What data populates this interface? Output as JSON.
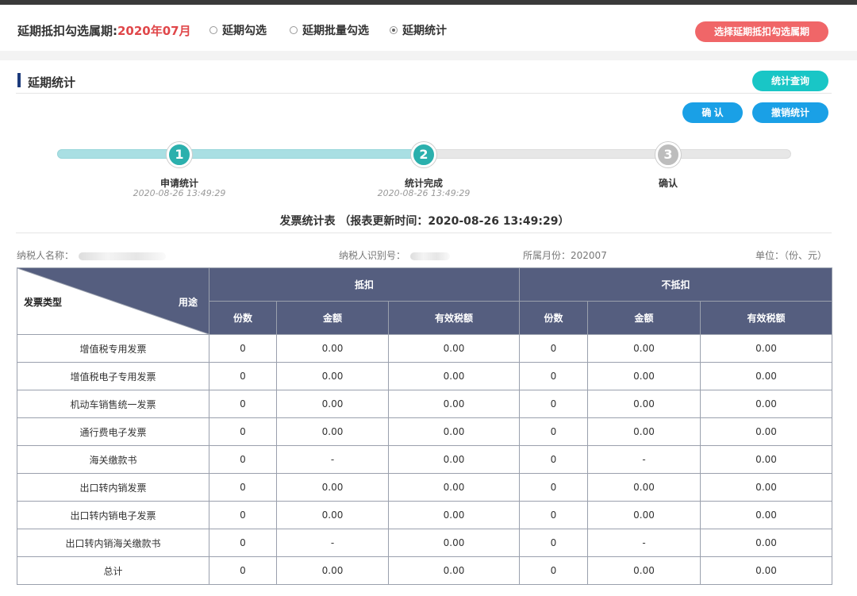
{
  "header": {
    "period_label": "延期抵扣勾选属期:",
    "period_value": "2020年07月",
    "radios": [
      {
        "label": "延期勾选",
        "checked": false
      },
      {
        "label": "延期批量勾选",
        "checked": false
      },
      {
        "label": "延期统计",
        "checked": true
      }
    ],
    "select_period_button": "选择延期抵扣勾选属期"
  },
  "section": {
    "title": "延期统计",
    "query_button": "统计查询",
    "confirm_button": "确 认",
    "cancel_button": "撤销统计"
  },
  "steps": [
    {
      "number": "1",
      "title": "申请统计",
      "time": "2020-08-26 13:49:29",
      "status": "done"
    },
    {
      "number": "2",
      "title": "统计完成",
      "time": "2020-08-26 13:49:29",
      "status": "done"
    },
    {
      "number": "3",
      "title": "确认",
      "time": "",
      "status": "todo"
    }
  ],
  "progress_fraction": 0.5,
  "report": {
    "title": "发票统计表 （报表更新时间：2020-08-26 13:49:29）",
    "taxpayer_name_label": "纳税人名称：",
    "taxpayer_id_label": "纳税人识别号：",
    "month_label": "所属月份：",
    "month_value": "202007",
    "unit_label": "单位：（份、元）"
  },
  "table": {
    "corner_left": "发票类型",
    "corner_right": "用途",
    "group_deduct": "抵扣",
    "group_nondeduct": "不抵扣",
    "sub_headers": [
      "份数",
      "金额",
      "有效税额",
      "份数",
      "金额",
      "有效税额"
    ],
    "rows": [
      {
        "type": "增值税专用发票",
        "cells": [
          "0",
          "0.00",
          "0.00",
          "0",
          "0.00",
          "0.00"
        ]
      },
      {
        "type": "增值税电子专用发票",
        "cells": [
          "0",
          "0.00",
          "0.00",
          "0",
          "0.00",
          "0.00"
        ]
      },
      {
        "type": "机动车销售统一发票",
        "cells": [
          "0",
          "0.00",
          "0.00",
          "0",
          "0.00",
          "0.00"
        ]
      },
      {
        "type": "通行费电子发票",
        "cells": [
          "0",
          "0.00",
          "0.00",
          "0",
          "0.00",
          "0.00"
        ]
      },
      {
        "type": "海关缴款书",
        "cells": [
          "0",
          "-",
          "0.00",
          "0",
          "-",
          "0.00"
        ]
      },
      {
        "type": "出口转内销发票",
        "cells": [
          "0",
          "0.00",
          "0.00",
          "0",
          "0.00",
          "0.00"
        ]
      },
      {
        "type": "出口转内销电子发票",
        "cells": [
          "0",
          "0.00",
          "0.00",
          "0",
          "0.00",
          "0.00"
        ]
      },
      {
        "type": "出口转内销海关缴款书",
        "cells": [
          "0",
          "-",
          "0.00",
          "0",
          "-",
          "0.00"
        ]
      },
      {
        "type": "总计",
        "cells": [
          "0",
          "0.00",
          "0.00",
          "0",
          "0.00",
          "0.00"
        ]
      }
    ]
  }
}
